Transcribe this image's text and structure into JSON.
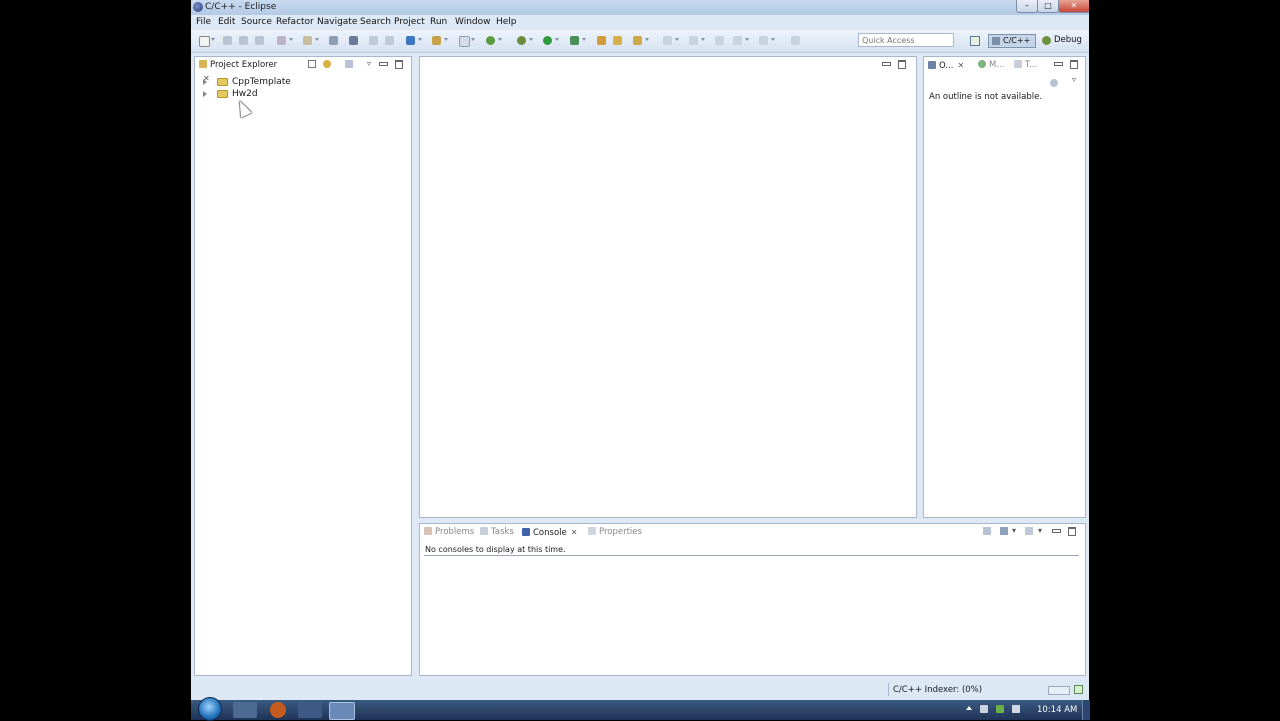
{
  "window": {
    "title": "C/C++ - Eclipse",
    "min_glyph": "–",
    "max_glyph": "□",
    "close_glyph": "✕"
  },
  "menu": [
    "File",
    "Edit",
    "Source",
    "Refactor",
    "Navigate",
    "Search",
    "Project",
    "Run",
    "Window",
    "Help"
  ],
  "toolbar": {
    "quick_access_placeholder": "Quick Access",
    "perspectives": {
      "active": "C/C++",
      "other": "Debug"
    }
  },
  "project_explorer": {
    "tab_label": "Project Explorer",
    "items": [
      {
        "label": "CppTemplate"
      },
      {
        "label": "Hw2d"
      }
    ]
  },
  "outline_panel": {
    "tabs": [
      {
        "label": "O..."
      },
      {
        "label": "M..."
      },
      {
        "label": "T..."
      }
    ],
    "message": "An outline is not available."
  },
  "bottom_panel": {
    "tabs": [
      {
        "label": "Problems"
      },
      {
        "label": "Tasks"
      },
      {
        "label": "Console"
      },
      {
        "label": "Properties"
      }
    ],
    "active_tab": "Console",
    "message": "No consoles to display at this time."
  },
  "status_bar": {
    "text": "C/C++ Indexer: (0%)"
  },
  "taskbar": {
    "clock": "10:14 AM"
  },
  "colors": {
    "window_bg": "#dfe9f5",
    "folder": "#e6c863",
    "taskbar": "#1e3357"
  }
}
